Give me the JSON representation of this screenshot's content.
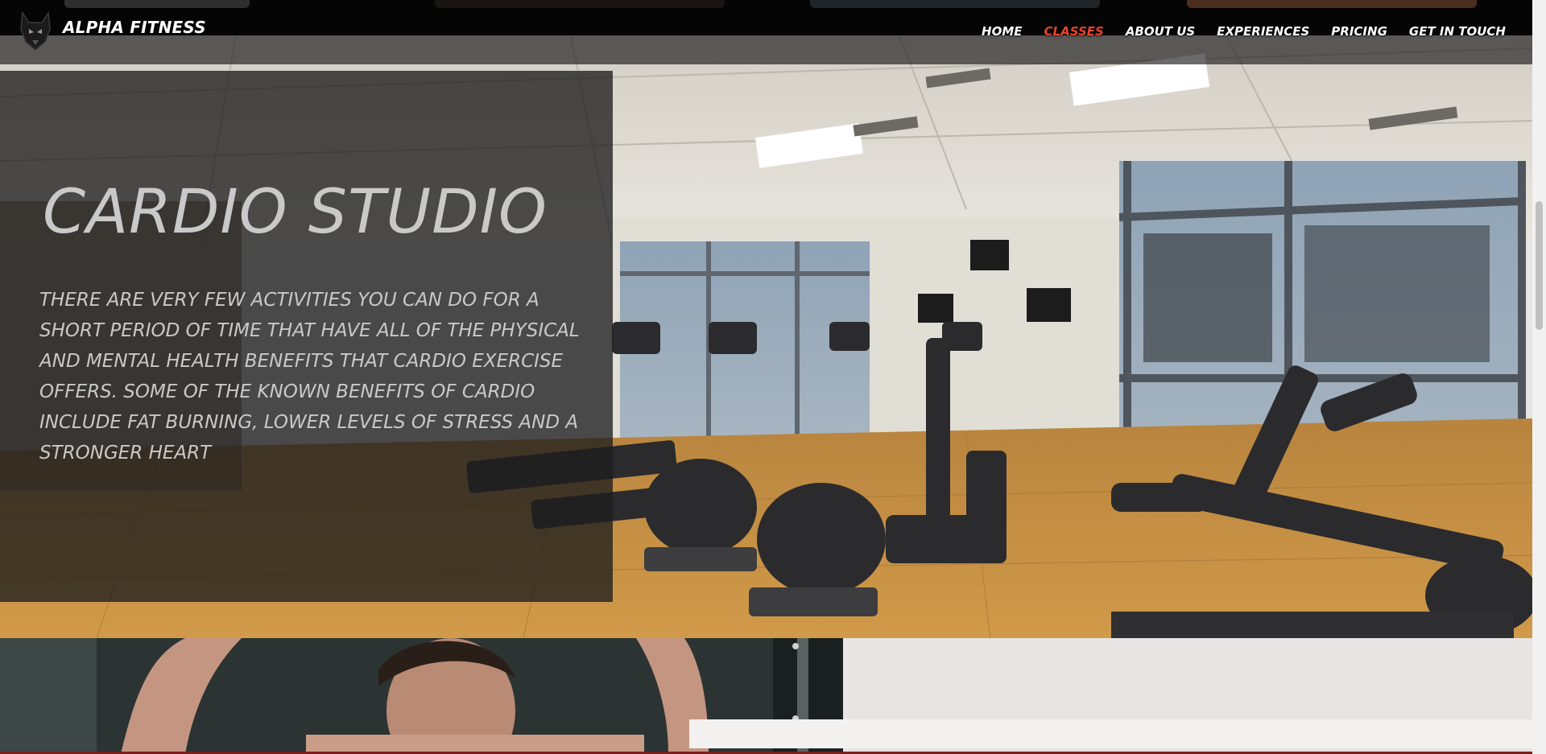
{
  "brand": {
    "name": "ALPHA FITNESS",
    "logo_icon": "wolf-logo-icon"
  },
  "nav": {
    "items": [
      {
        "label": "HOME"
      },
      {
        "label": "CLASSES"
      },
      {
        "label": "ABOUT US"
      },
      {
        "label": "EXPERIENCES"
      },
      {
        "label": "PRICING"
      },
      {
        "label": "GET IN TOUCH"
      }
    ],
    "active": "CLASSES"
  },
  "hero": {
    "title": "CARDIO STUDIO",
    "body": "THERE ARE VERY FEW ACTIVITIES YOU CAN DO FOR A SHORT PERIOD OF TIME THAT HAVE ALL OF THE PHYSICAL AND MENTAL HEALTH BENEFITS THAT CARDIO EXERCISE OFFERS. SOME OF THE KNOWN BENEFITS OF CARDIO INCLUDE FAT BURNING, LOWER LEVELS OF STRESS AND A STRONGER HEART"
  },
  "colors": {
    "accent": "#e8442b",
    "nav_text": "#ffffff",
    "overlay": "#1e1e1e",
    "hero_text": "#c9c9c9"
  }
}
